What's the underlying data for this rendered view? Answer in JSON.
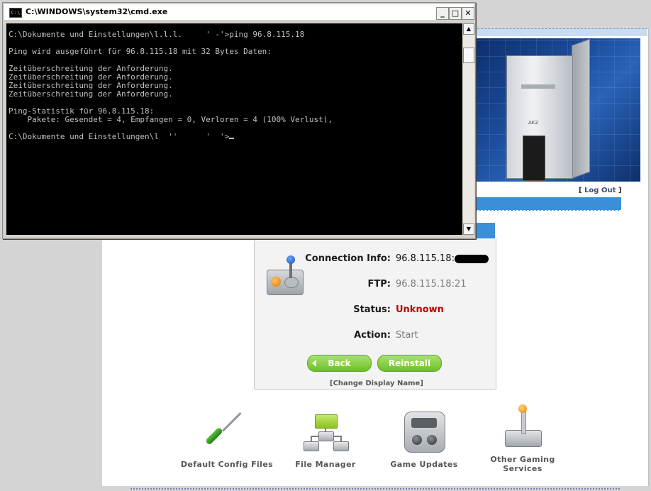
{
  "cmd": {
    "title": "C:\\WINDOWS\\system32\\cmd.exe",
    "icon_text": "C:\\",
    "minimize_symbol": "_",
    "maximize_symbol": "□",
    "close_symbol": "✕",
    "scroll_up": "▲",
    "scroll_down": "▼",
    "lines": [
      "C:\\Dokumente und Einstellungen\\l.l.l.     ' -'>ping 96.8.115.18",
      "",
      "Ping wird ausgeführt für 96.8.115.18 mit 32 Bytes Daten:",
      "",
      "Zeitüberschreitung der Anforderung.",
      "Zeitüberschreitung der Anforderung.",
      "Zeitüberschreitung der Anforderung.",
      "Zeitüberschreitung der Anforderung.",
      "",
      "Ping-Statistik für 96.8.115.18:",
      "    Pakete: Gesendet = 4, Empfangen = 0, Verloren = 4 (100% Verlust),",
      ""
    ],
    "prompt_line": "C:\\Dokumente und Einstellungen\\l  ''      '  '>"
  },
  "header": {
    "logout_open": "[ ",
    "logout_label": "Log Out",
    "logout_close": " ]",
    "tower_brand": "AK2"
  },
  "server": {
    "connection_label": "Connection Info:",
    "connection_value": "96.8.115.18:",
    "ftp_label": "FTP:",
    "ftp_value": "96.8.115.18:21",
    "status_label": "Status:",
    "status_value": "Unknown",
    "action_label": "Action:",
    "action_value": "Start",
    "back_label": "Back",
    "reinstall_label": "Reinstall",
    "change_display_name": "[Change Display Name]"
  },
  "tools": [
    {
      "label": "Default Config Files",
      "icon": "screwdriver-icon"
    },
    {
      "label": "File Manager",
      "icon": "network-icon"
    },
    {
      "label": "Game Updates",
      "icon": "game-console-icon"
    },
    {
      "label": "Other Gaming\nServices",
      "icon": "joystick-icon"
    }
  ],
  "colors": {
    "accent_blue": "#3b8fd6",
    "button_green": "#6cbf2a",
    "status_red": "#c00000"
  }
}
